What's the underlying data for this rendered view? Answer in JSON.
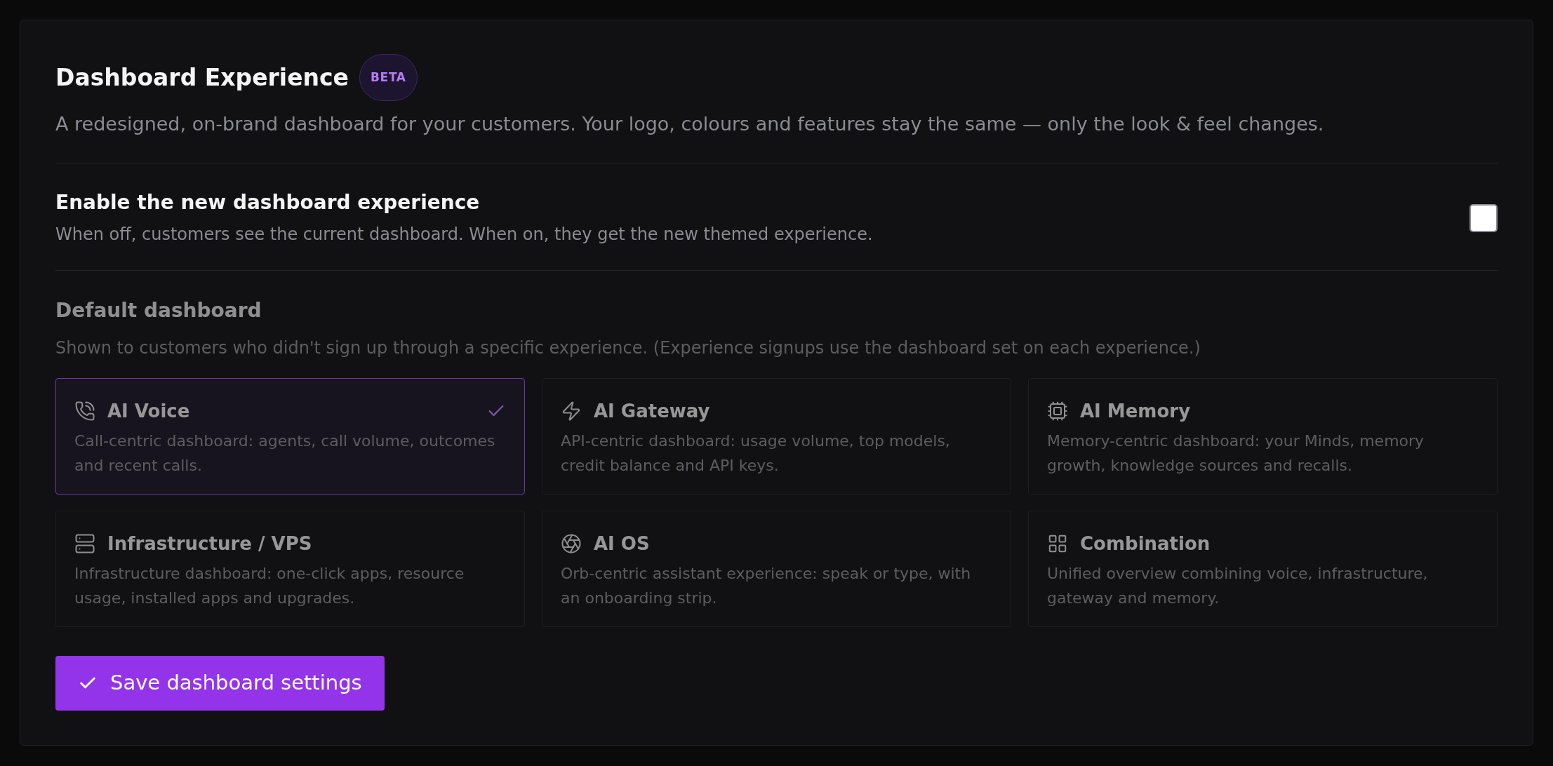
{
  "header": {
    "title": "Dashboard Experience",
    "badge": "BETA",
    "description": "A redesigned, on-brand dashboard for your customers. Your logo, colours and features stay the same — only the look & feel changes."
  },
  "enable_setting": {
    "label": "Enable the new dashboard experience",
    "description": "When off, customers see the current dashboard. When on, they get the new themed experience.",
    "checked": false
  },
  "default_dashboard": {
    "heading": "Default dashboard",
    "description": "Shown to customers who didn't sign up through a specific experience. (Experience signups use the dashboard set on each experience.)",
    "disabled": true,
    "options": [
      {
        "title": "AI Voice",
        "description": "Call-centric dashboard: agents, call volume, outcomes and recent calls.",
        "selected": true
      },
      {
        "title": "AI Gateway",
        "description": "API-centric dashboard: usage volume, top models, credit balance and API keys.",
        "selected": false
      },
      {
        "title": "AI Memory",
        "description": "Memory-centric dashboard: your Minds, memory growth, knowledge sources and recalls.",
        "selected": false
      },
      {
        "title": "Infrastructure / VPS",
        "description": "Infrastructure dashboard: one-click apps, resource usage, installed apps and upgrades.",
        "selected": false
      },
      {
        "title": "AI OS",
        "description": "Orb-centric assistant experience: speak or type, with an onboarding strip.",
        "selected": false
      },
      {
        "title": "Combination",
        "description": "Unified overview combining voice, infrastructure, gateway and memory.",
        "selected": false
      }
    ]
  },
  "save_button": {
    "label": "Save dashboard settings"
  }
}
